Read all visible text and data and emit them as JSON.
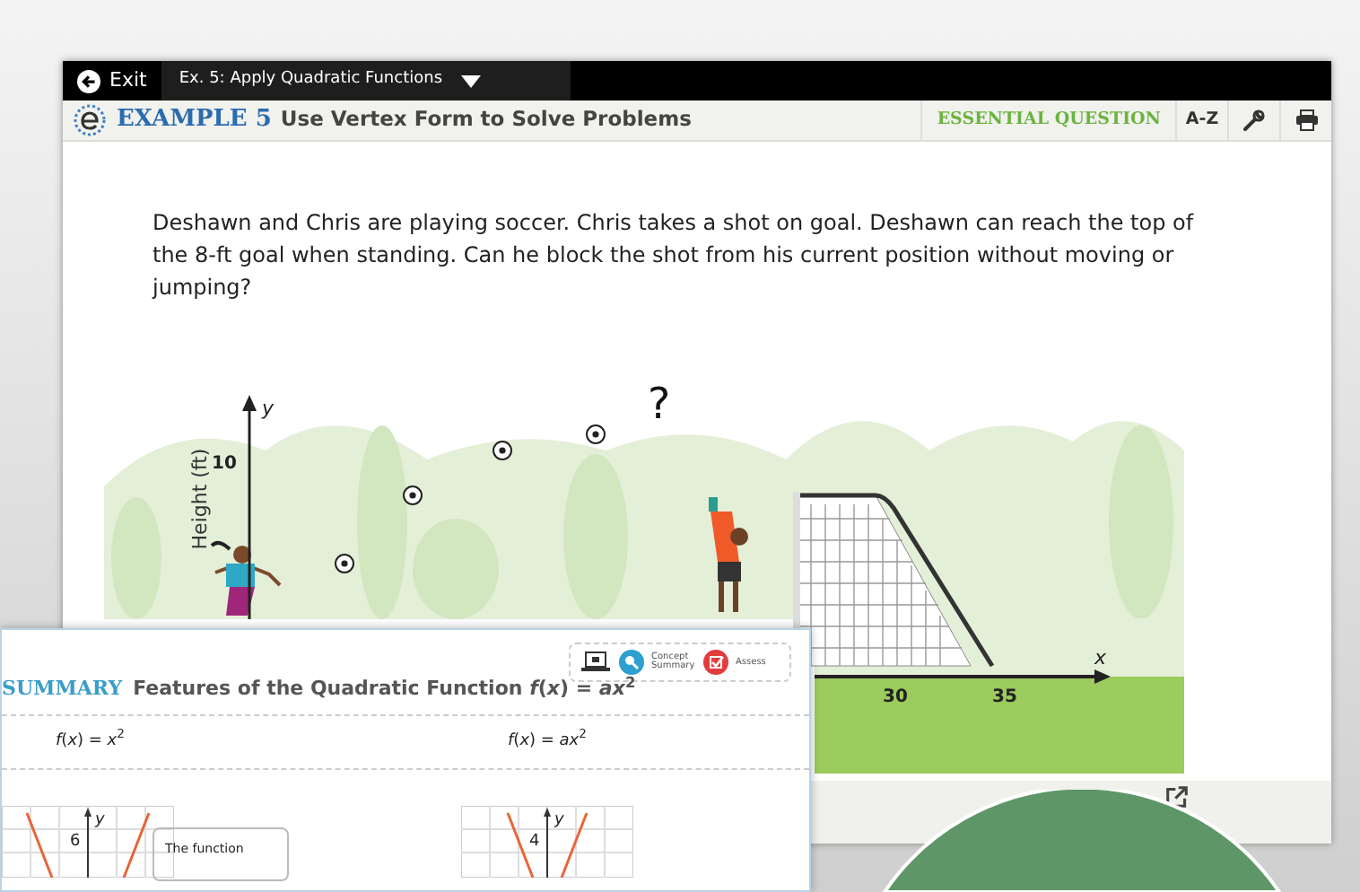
{
  "top_bar": {
    "exit_label": "Exit",
    "lesson_menu": "Ex. 5: Apply Quadratic Functions"
  },
  "header": {
    "example_number": "EXAMPLE 5",
    "title": "Use Vertex Form to Solve Problems",
    "essential_question": "ESSENTIAL QUESTION",
    "glossary_button": "A-Z"
  },
  "problem_text": "Deshawn and Chris are playing soccer. Chris takes a shot on goal. Deshawn can reach the top of the 8-ft goal when standing. Can he block the shot from his current position without moving or jumping?",
  "illustration": {
    "y_axis_label": "y",
    "y_axis_title": "Height (ft)",
    "y_tick": "10",
    "question_mark": "?",
    "x_ticks": [
      "30",
      "35"
    ],
    "x_axis_label": "x"
  },
  "summary_panel": {
    "tools": [
      {
        "kind": "laptop"
      },
      {
        "kind": "concept",
        "label": "Concept Summary"
      },
      {
        "kind": "assess",
        "label": "Assess"
      }
    ],
    "heading_label": "SUMMARY",
    "heading": "Features of the Quadratic Function *f*(*x*) = *ax*$^{2}$",
    "columns": [
      {
        "formula": "*f*(*x*) = *x*$^{2}$",
        "graph_tick": "6",
        "graph_axis": "y",
        "note": "The function"
      },
      {
        "formula": "*f*(*x*) = *ax*$^{2}$",
        "graph_tick": "4",
        "graph_axis": "y"
      }
    ]
  }
}
